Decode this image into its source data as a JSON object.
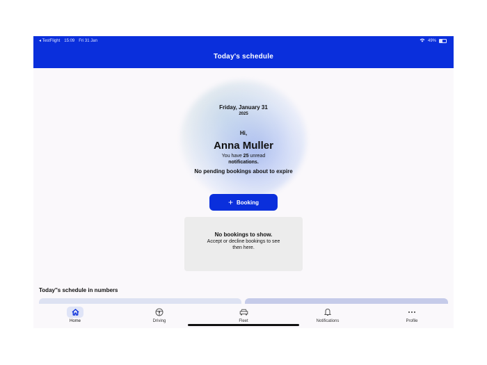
{
  "status_bar": {
    "back_app": "◂ TestFlight",
    "time": "15:09",
    "date": "Fri 31 Jan",
    "battery": "49%"
  },
  "header": {
    "title": "Today's schedule"
  },
  "greeting": {
    "date": "Friday, January 31",
    "year": "2025",
    "hi": "Hi,",
    "name": "Anna Muller",
    "unread_prefix": "You have",
    "unread_count": "25",
    "unread_suffix": "unread",
    "unread_line2": "notifications.",
    "pending": "No pending bookings about to expire"
  },
  "booking_button": {
    "icon": "plus-icon",
    "label": "Booking"
  },
  "empty_state": {
    "title": "No bookings to show.",
    "subtitle": "Accept or decline bookings to see then here."
  },
  "section": {
    "title": "Today''s schedule in numbers"
  },
  "tabs": [
    {
      "label": "Home",
      "icon": "home-icon",
      "active": true
    },
    {
      "label": "Driving",
      "icon": "steering-wheel-icon",
      "active": false
    },
    {
      "label": "Fleet",
      "icon": "car-icon",
      "active": false
    },
    {
      "label": "Notifications",
      "icon": "bell-icon",
      "active": false
    },
    {
      "label": "Profile",
      "icon": "more-dots-icon",
      "active": false
    }
  ],
  "colors": {
    "brand": "#0a2fdc",
    "background": "#faf8fb",
    "card": "#ececec"
  }
}
